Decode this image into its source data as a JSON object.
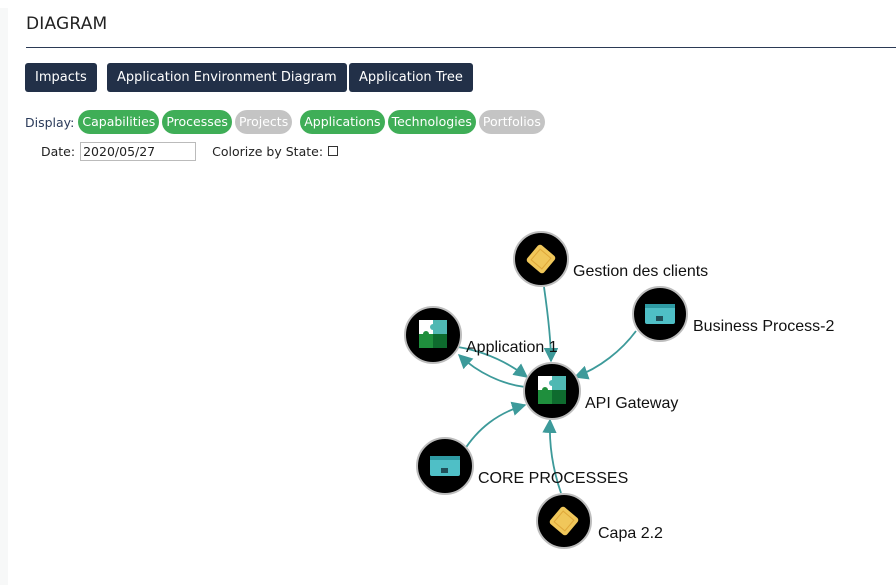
{
  "header": {
    "title": "DIAGRAM"
  },
  "toolbar": {
    "impacts_label": "Impacts",
    "env_diagram_label": "Application Environment Diagram",
    "app_tree_label": "Application Tree"
  },
  "display": {
    "label": "Display:",
    "filters": [
      {
        "label": "Capabilities",
        "active": true
      },
      {
        "label": "Processes",
        "active": true
      },
      {
        "label": "Projects",
        "active": false
      },
      {
        "label": "Applications",
        "active": true
      },
      {
        "label": "Technologies",
        "active": true
      },
      {
        "label": "Portfolios",
        "active": false
      }
    ]
  },
  "controls": {
    "date_label": "Date:",
    "date_value": "2020/05/27",
    "colorize_label": "Colorize by State:"
  },
  "colors": {
    "button_bg": "#223048",
    "pill_active": "#3fae57",
    "pill_inactive": "#c4c4c4",
    "edge": "#3d9a9a",
    "node_bg": "#000000"
  },
  "diagram": {
    "nodes": {
      "center": {
        "label": "API Gateway",
        "icon": "application-puzzle-icon"
      },
      "gestion": {
        "label": "Gestion des clients",
        "icon": "capability-icon"
      },
      "business": {
        "label": "Business Process-2",
        "icon": "process-icon"
      },
      "app1": {
        "label": "Application 1",
        "icon": "application-puzzle-icon"
      },
      "core": {
        "label": "CORE PROCESSES",
        "icon": "process-icon"
      },
      "capa": {
        "label": "Capa 2.2",
        "icon": "capability-icon"
      }
    }
  }
}
